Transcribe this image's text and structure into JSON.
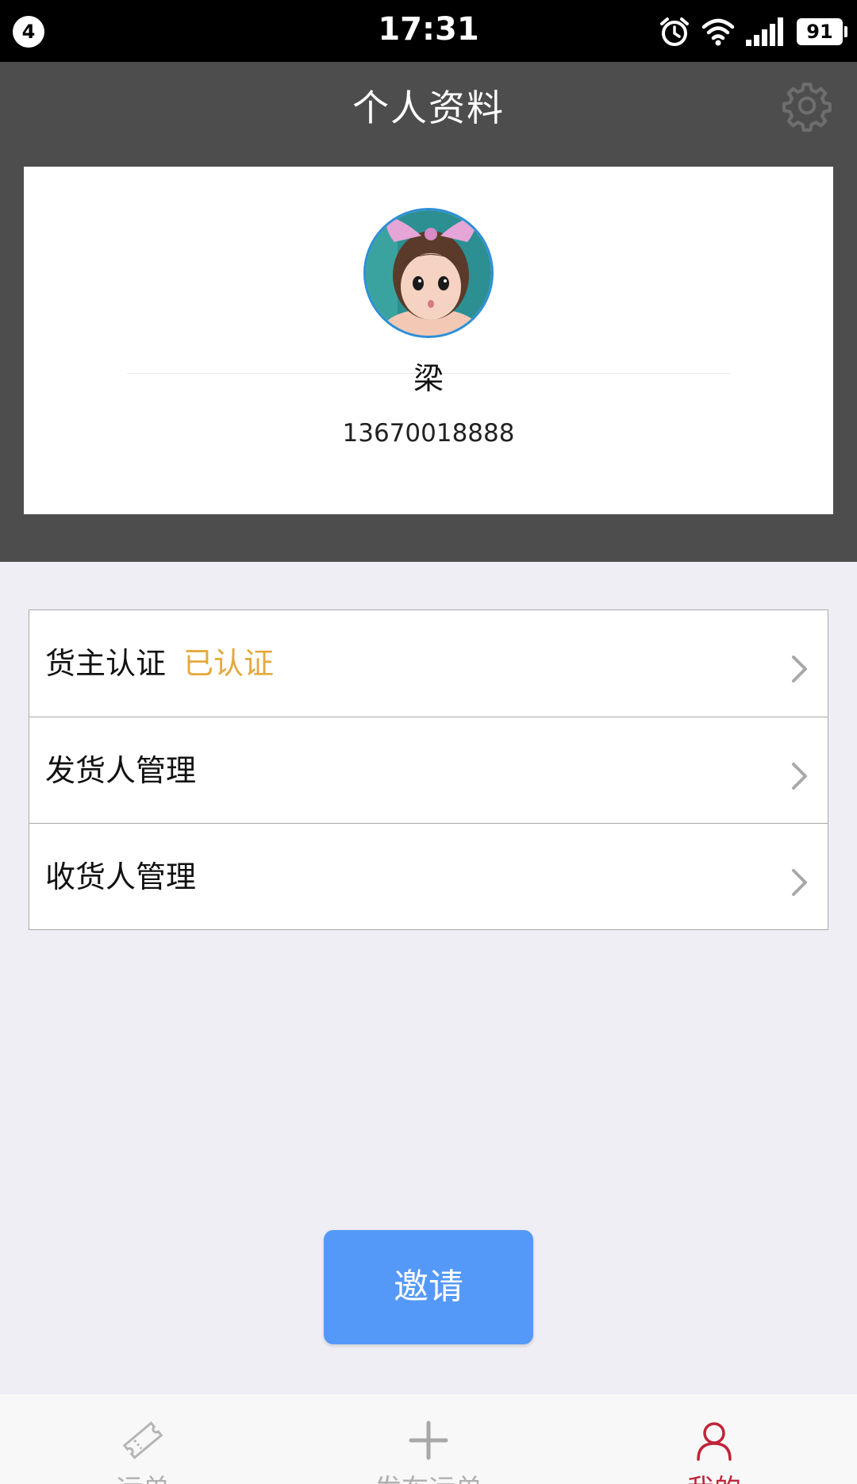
{
  "status_bar": {
    "notification_count": "4",
    "time": "17:31",
    "battery": "91"
  },
  "header": {
    "title": "个人资料",
    "settings_icon": "gear-icon"
  },
  "profile": {
    "name": "梁",
    "phone": "13670018888",
    "avatar": "doll-avatar"
  },
  "menu": {
    "items": [
      {
        "label": "货主认证",
        "status": "已认证"
      },
      {
        "label": "发货人管理"
      },
      {
        "label": "收货人管理"
      }
    ]
  },
  "actions": {
    "invite_label": "邀请"
  },
  "bottom_nav": {
    "items": [
      {
        "label": "运单",
        "icon": "ticket-icon",
        "active": false
      },
      {
        "label": "发布运单",
        "icon": "plus-icon",
        "active": false
      },
      {
        "label": "我的",
        "icon": "person-icon",
        "active": true
      }
    ]
  },
  "colors": {
    "header_bg": "#4d4d4d",
    "accent_blue": "#5599f8",
    "verified_orange": "#e5a93c",
    "active_tab": "#c0243a",
    "page_bg": "#eeeef4"
  }
}
